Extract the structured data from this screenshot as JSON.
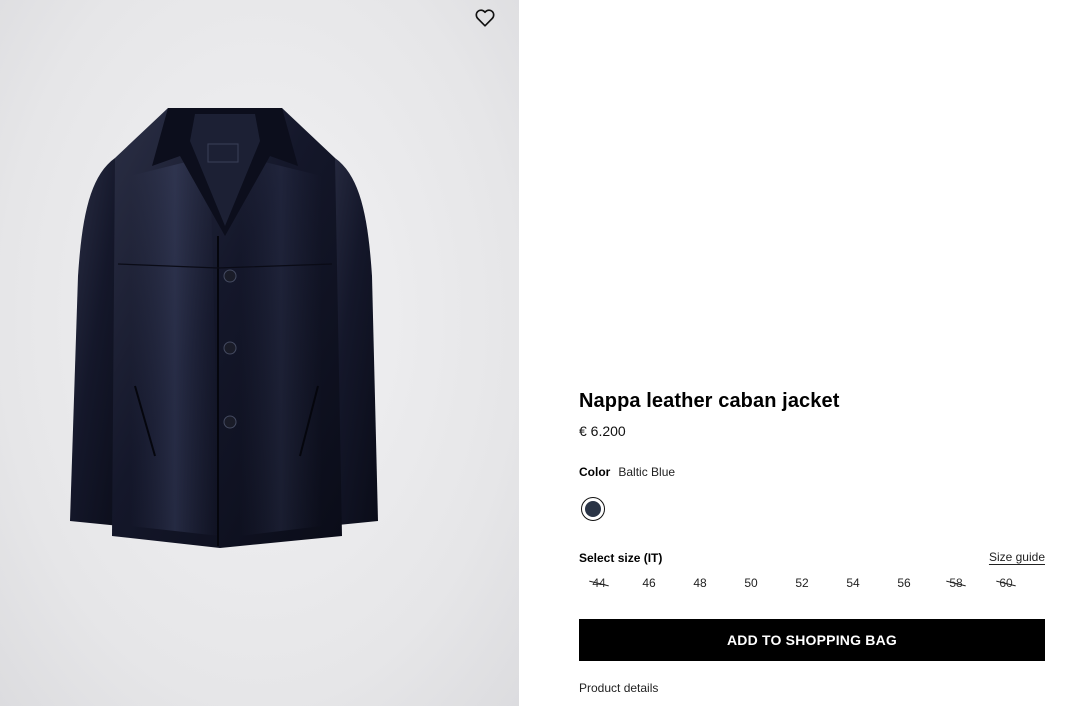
{
  "product": {
    "title": "Nappa leather caban jacket",
    "price": "€ 6.200",
    "image_alt": "Nappa leather caban jacket product image"
  },
  "wishlist": {
    "icon": "heart-outline-icon"
  },
  "color": {
    "label": "Color",
    "selected": "Baltic Blue",
    "swatches": [
      {
        "name": "Baltic Blue",
        "hex": "#2a3446",
        "selected": true
      }
    ]
  },
  "size": {
    "label": "Select size (IT)",
    "guide_label": "Size guide",
    "options": [
      {
        "label": "44",
        "available": false
      },
      {
        "label": "46",
        "available": true
      },
      {
        "label": "48",
        "available": true
      },
      {
        "label": "50",
        "available": true
      },
      {
        "label": "52",
        "available": true
      },
      {
        "label": "54",
        "available": true
      },
      {
        "label": "56",
        "available": true
      },
      {
        "label": "58",
        "available": false
      },
      {
        "label": "60",
        "available": false
      }
    ]
  },
  "cart": {
    "add_label": "ADD TO SHOPPING BAG"
  },
  "details": {
    "label": "Product details"
  }
}
